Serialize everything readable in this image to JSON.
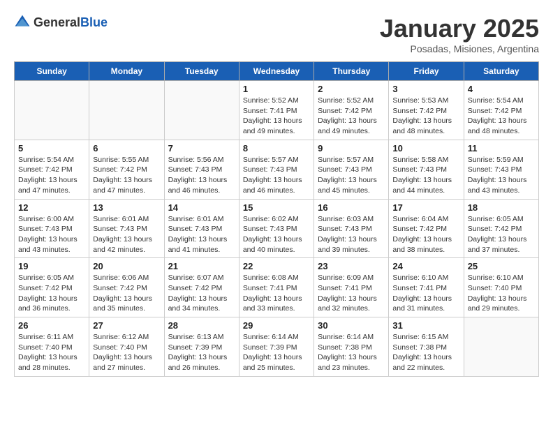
{
  "header": {
    "logo_general": "General",
    "logo_blue": "Blue",
    "month_title": "January 2025",
    "subtitle": "Posadas, Misiones, Argentina"
  },
  "days_of_week": [
    "Sunday",
    "Monday",
    "Tuesday",
    "Wednesday",
    "Thursday",
    "Friday",
    "Saturday"
  ],
  "weeks": [
    [
      {
        "day": "",
        "info": ""
      },
      {
        "day": "",
        "info": ""
      },
      {
        "day": "",
        "info": ""
      },
      {
        "day": "1",
        "info": "Sunrise: 5:52 AM\nSunset: 7:41 PM\nDaylight: 13 hours\nand 49 minutes."
      },
      {
        "day": "2",
        "info": "Sunrise: 5:52 AM\nSunset: 7:42 PM\nDaylight: 13 hours\nand 49 minutes."
      },
      {
        "day": "3",
        "info": "Sunrise: 5:53 AM\nSunset: 7:42 PM\nDaylight: 13 hours\nand 48 minutes."
      },
      {
        "day": "4",
        "info": "Sunrise: 5:54 AM\nSunset: 7:42 PM\nDaylight: 13 hours\nand 48 minutes."
      }
    ],
    [
      {
        "day": "5",
        "info": "Sunrise: 5:54 AM\nSunset: 7:42 PM\nDaylight: 13 hours\nand 47 minutes."
      },
      {
        "day": "6",
        "info": "Sunrise: 5:55 AM\nSunset: 7:42 PM\nDaylight: 13 hours\nand 47 minutes."
      },
      {
        "day": "7",
        "info": "Sunrise: 5:56 AM\nSunset: 7:43 PM\nDaylight: 13 hours\nand 46 minutes."
      },
      {
        "day": "8",
        "info": "Sunrise: 5:57 AM\nSunset: 7:43 PM\nDaylight: 13 hours\nand 46 minutes."
      },
      {
        "day": "9",
        "info": "Sunrise: 5:57 AM\nSunset: 7:43 PM\nDaylight: 13 hours\nand 45 minutes."
      },
      {
        "day": "10",
        "info": "Sunrise: 5:58 AM\nSunset: 7:43 PM\nDaylight: 13 hours\nand 44 minutes."
      },
      {
        "day": "11",
        "info": "Sunrise: 5:59 AM\nSunset: 7:43 PM\nDaylight: 13 hours\nand 43 minutes."
      }
    ],
    [
      {
        "day": "12",
        "info": "Sunrise: 6:00 AM\nSunset: 7:43 PM\nDaylight: 13 hours\nand 43 minutes."
      },
      {
        "day": "13",
        "info": "Sunrise: 6:01 AM\nSunset: 7:43 PM\nDaylight: 13 hours\nand 42 minutes."
      },
      {
        "day": "14",
        "info": "Sunrise: 6:01 AM\nSunset: 7:43 PM\nDaylight: 13 hours\nand 41 minutes."
      },
      {
        "day": "15",
        "info": "Sunrise: 6:02 AM\nSunset: 7:43 PM\nDaylight: 13 hours\nand 40 minutes."
      },
      {
        "day": "16",
        "info": "Sunrise: 6:03 AM\nSunset: 7:43 PM\nDaylight: 13 hours\nand 39 minutes."
      },
      {
        "day": "17",
        "info": "Sunrise: 6:04 AM\nSunset: 7:42 PM\nDaylight: 13 hours\nand 38 minutes."
      },
      {
        "day": "18",
        "info": "Sunrise: 6:05 AM\nSunset: 7:42 PM\nDaylight: 13 hours\nand 37 minutes."
      }
    ],
    [
      {
        "day": "19",
        "info": "Sunrise: 6:05 AM\nSunset: 7:42 PM\nDaylight: 13 hours\nand 36 minutes."
      },
      {
        "day": "20",
        "info": "Sunrise: 6:06 AM\nSunset: 7:42 PM\nDaylight: 13 hours\nand 35 minutes."
      },
      {
        "day": "21",
        "info": "Sunrise: 6:07 AM\nSunset: 7:42 PM\nDaylight: 13 hours\nand 34 minutes."
      },
      {
        "day": "22",
        "info": "Sunrise: 6:08 AM\nSunset: 7:41 PM\nDaylight: 13 hours\nand 33 minutes."
      },
      {
        "day": "23",
        "info": "Sunrise: 6:09 AM\nSunset: 7:41 PM\nDaylight: 13 hours\nand 32 minutes."
      },
      {
        "day": "24",
        "info": "Sunrise: 6:10 AM\nSunset: 7:41 PM\nDaylight: 13 hours\nand 31 minutes."
      },
      {
        "day": "25",
        "info": "Sunrise: 6:10 AM\nSunset: 7:40 PM\nDaylight: 13 hours\nand 29 minutes."
      }
    ],
    [
      {
        "day": "26",
        "info": "Sunrise: 6:11 AM\nSunset: 7:40 PM\nDaylight: 13 hours\nand 28 minutes."
      },
      {
        "day": "27",
        "info": "Sunrise: 6:12 AM\nSunset: 7:40 PM\nDaylight: 13 hours\nand 27 minutes."
      },
      {
        "day": "28",
        "info": "Sunrise: 6:13 AM\nSunset: 7:39 PM\nDaylight: 13 hours\nand 26 minutes."
      },
      {
        "day": "29",
        "info": "Sunrise: 6:14 AM\nSunset: 7:39 PM\nDaylight: 13 hours\nand 25 minutes."
      },
      {
        "day": "30",
        "info": "Sunrise: 6:14 AM\nSunset: 7:38 PM\nDaylight: 13 hours\nand 23 minutes."
      },
      {
        "day": "31",
        "info": "Sunrise: 6:15 AM\nSunset: 7:38 PM\nDaylight: 13 hours\nand 22 minutes."
      },
      {
        "day": "",
        "info": ""
      }
    ]
  ]
}
